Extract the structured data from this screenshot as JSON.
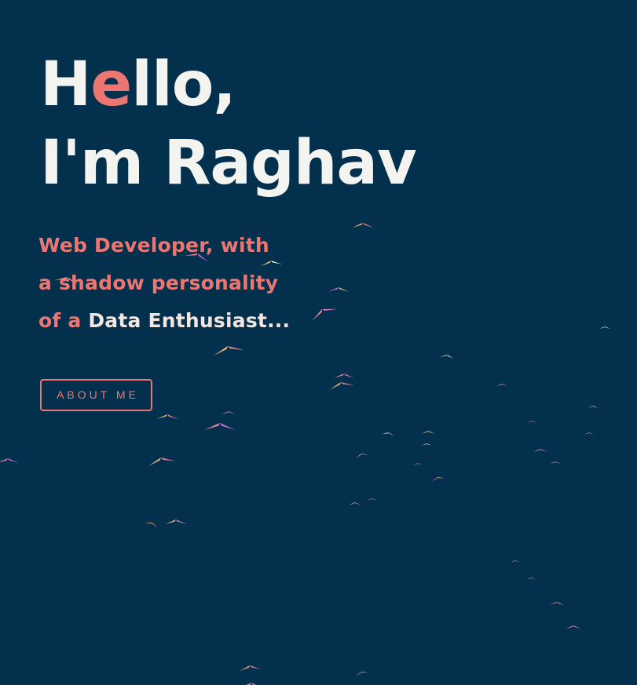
{
  "hero": {
    "title_line1": [
      "H",
      "e",
      "l",
      "l",
      "o",
      ","
    ],
    "title_line1_accent_index": 1,
    "title_line2": "I'm Raghav",
    "subtitle_line1": "Web Developer, with",
    "subtitle_line2": "a shadow personality",
    "subtitle_line3_prefix": "of a ",
    "subtitle_line3_highlight": "Data Enthusiast...",
    "about_button": "ABOUT ME"
  },
  "colors": {
    "background": "#03304d",
    "text": "#f3f3ef",
    "accent": "#ec7772",
    "highlight": "#f3e6e1",
    "bird_palette": [
      "#f7b27a",
      "#f08aa0",
      "#e873d8",
      "#f7d78a",
      "#ffffff"
    ]
  },
  "decor": {
    "background_animation": "flock of small origami-style birds"
  }
}
